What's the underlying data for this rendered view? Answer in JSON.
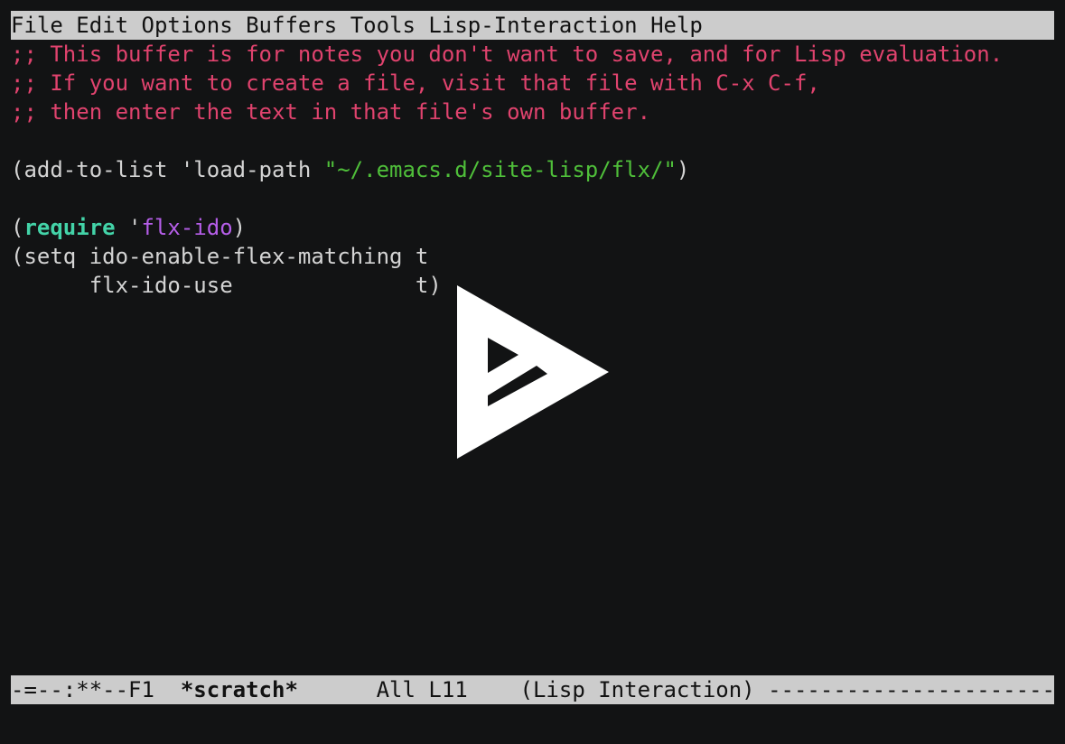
{
  "menubar": {
    "items": [
      "File",
      "Edit",
      "Options",
      "Buffers",
      "Tools",
      "Lisp-Interaction",
      "Help"
    ]
  },
  "buffer": {
    "comment1": ";; This buffer is for notes you don't want to save, and for Lisp evaluation.",
    "comment2": ";; If you want to create a file, visit that file with C-x C-f,",
    "comment3": ";; then enter the text in that file's own buffer.",
    "line5_open": "(add-to-list 'load-path ",
    "line5_string": "\"~/.emacs.d/site-lisp/flx/\"",
    "line5_close": ")",
    "line7_open": "(",
    "line7_keyword": "require",
    "line7_quote": " '",
    "line7_constant": "flx-ido",
    "line7_close": ")",
    "line8": "(setq ido-enable-flex-matching t",
    "line9": "      flx-ido-use              t)"
  },
  "modeline": {
    "prefix": "-=--:**--F1  ",
    "buffer_name": "*scratch*",
    "position": "      All L11    ",
    "mode": "(Lisp Interaction) ",
    "fill": "----------------------"
  },
  "overlay": {
    "icon": "asciinema-play-icon",
    "color": "#ffffff"
  }
}
